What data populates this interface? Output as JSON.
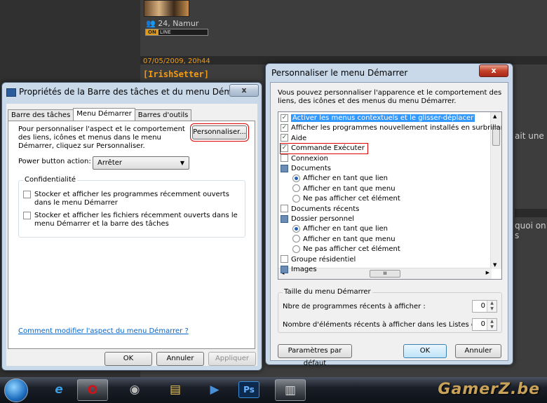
{
  "forum": {
    "user_location": "24, Namur",
    "status_on": "ON",
    "status_line": "LINE",
    "post_date": "07/05/2009, 20h44",
    "poster": "[IrishSetter]",
    "snippet_1": "ait une",
    "snippet_2": "quoi on s"
  },
  "taskbar_props": {
    "title": "Propriétés de la Barre des tâches et du menu Démarrer",
    "close_label": "x",
    "tabs": [
      "Barre des tâches",
      "Menu Démarrer",
      "Barres d'outils"
    ],
    "active_tab": 1,
    "description": "Pour personnaliser l'aspect et le comportement des liens, icônes et menus dans le menu Démarrer, cliquez sur Personnaliser.",
    "customize_label": "Personnaliser...",
    "power_label": "Power button action:",
    "power_value": "Arrêter",
    "privacy_title": "Confidentialité",
    "privacy_1": "Stocker et afficher les programmes récemment ouverts dans le menu Démarrer",
    "privacy_2": "Stocker et afficher les fichiers récemment ouverts dans le menu Démarrer et la barre des tâches",
    "help_link": "Comment modifier l'aspect du menu Démarrer ?",
    "ok_label": "OK",
    "cancel_label": "Annuler",
    "apply_label": "Appliquer"
  },
  "customize": {
    "title": "Personnaliser le menu Démarrer",
    "close_label": "x",
    "description": "Vous pouvez personnaliser l'apparence et le comportement des liens, des icônes et des menus du menu Démarrer.",
    "items": [
      {
        "label": "Activer les menus contextuels et le glisser-déplacer",
        "kind": "check",
        "checked": true,
        "selected": true
      },
      {
        "label": "Afficher les programmes nouvellement installés en surbrillance",
        "kind": "check",
        "checked": true
      },
      {
        "label": "Aide",
        "kind": "check",
        "checked": true
      },
      {
        "label": "Commande Exécuter",
        "kind": "check",
        "checked": true,
        "highlighted": true
      },
      {
        "label": "Connexion",
        "kind": "check",
        "checked": false
      },
      {
        "label": "Documents",
        "kind": "folder"
      },
      {
        "label": "Afficher en tant que lien",
        "kind": "radio",
        "checked": true,
        "indent": true
      },
      {
        "label": "Afficher en tant que menu",
        "kind": "radio",
        "checked": false,
        "indent": true
      },
      {
        "label": "Ne pas afficher cet élément",
        "kind": "radio",
        "checked": false,
        "indent": true
      },
      {
        "label": "Documents récents",
        "kind": "check",
        "checked": false
      },
      {
        "label": "Dossier personnel",
        "kind": "folder"
      },
      {
        "label": "Afficher en tant que lien",
        "kind": "radio",
        "checked": true,
        "indent": true
      },
      {
        "label": "Afficher en tant que menu",
        "kind": "radio",
        "checked": false,
        "indent": true
      },
      {
        "label": "Ne pas afficher cet élément",
        "kind": "radio",
        "checked": false,
        "indent": true
      },
      {
        "label": "Groupe résidentiel",
        "kind": "check",
        "checked": false
      },
      {
        "label": "Images",
        "kind": "folder"
      }
    ],
    "hscroll_label": "III",
    "size_group_title": "Taille du menu Démarrer",
    "recent_programs_label": "Nbre de programmes récents à afficher :",
    "recent_programs_value": "0",
    "recent_items_label": "Nombre d'éléments récents à afficher dans les Listes de",
    "recent_items_value": "0",
    "defaults_label": "Paramètres par défaut",
    "ok_label": "OK",
    "cancel_label": "Annuler"
  },
  "taskbar": {
    "brand": "GamerZ.be",
    "items": [
      "start-orb-icon",
      "internet-explorer-icon",
      "opera-icon",
      "media-icon",
      "file-explorer-icon",
      "media-player-icon",
      "photoshop-icon",
      "control-panel-icon"
    ],
    "ps_label": "Ps"
  }
}
